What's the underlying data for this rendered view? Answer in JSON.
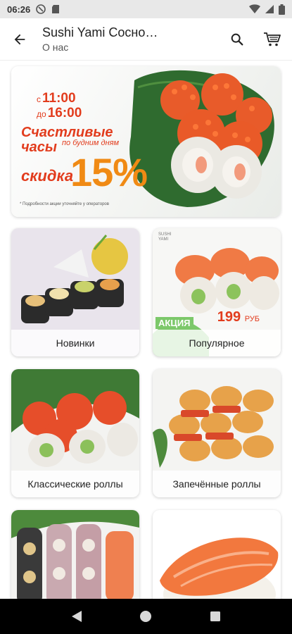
{
  "status_bar": {
    "time": "06:26"
  },
  "app_bar": {
    "title": "Sushi Yami Сосно…",
    "subtitle": "О нас"
  },
  "promo": {
    "from_prefix": "с",
    "from_time": "11:00",
    "to_prefix": "до",
    "to_time": "16:00",
    "headline_line1": "Счастливые",
    "headline_line2": "часы",
    "weekdays": "по будним дням",
    "discount_label": "скидка",
    "discount_value": "15%",
    "note": "* Подробности акции уточняйте у операторов"
  },
  "categories": [
    {
      "label": "Новинки"
    },
    {
      "label": "Популярное",
      "badge": "АКЦИЯ",
      "price": "199",
      "currency": "РУБ",
      "logo_line1": "SUSHI",
      "logo_line2": "YAMI"
    },
    {
      "label": "Классические роллы"
    },
    {
      "label": "Запечённые роллы"
    },
    {
      "label": ""
    },
    {
      "label": ""
    }
  ],
  "colors": {
    "accent_red": "#e23c1d",
    "accent_orange": "#f08a14",
    "nav_background": "#000000",
    "status_background": "#e8e8e8"
  },
  "icons": {
    "back": "arrow-left-icon",
    "search": "search-icon",
    "cart": "cart-icon",
    "nav_back": "nav-back-icon",
    "nav_home": "nav-home-icon",
    "nav_recents": "nav-recents-icon"
  }
}
